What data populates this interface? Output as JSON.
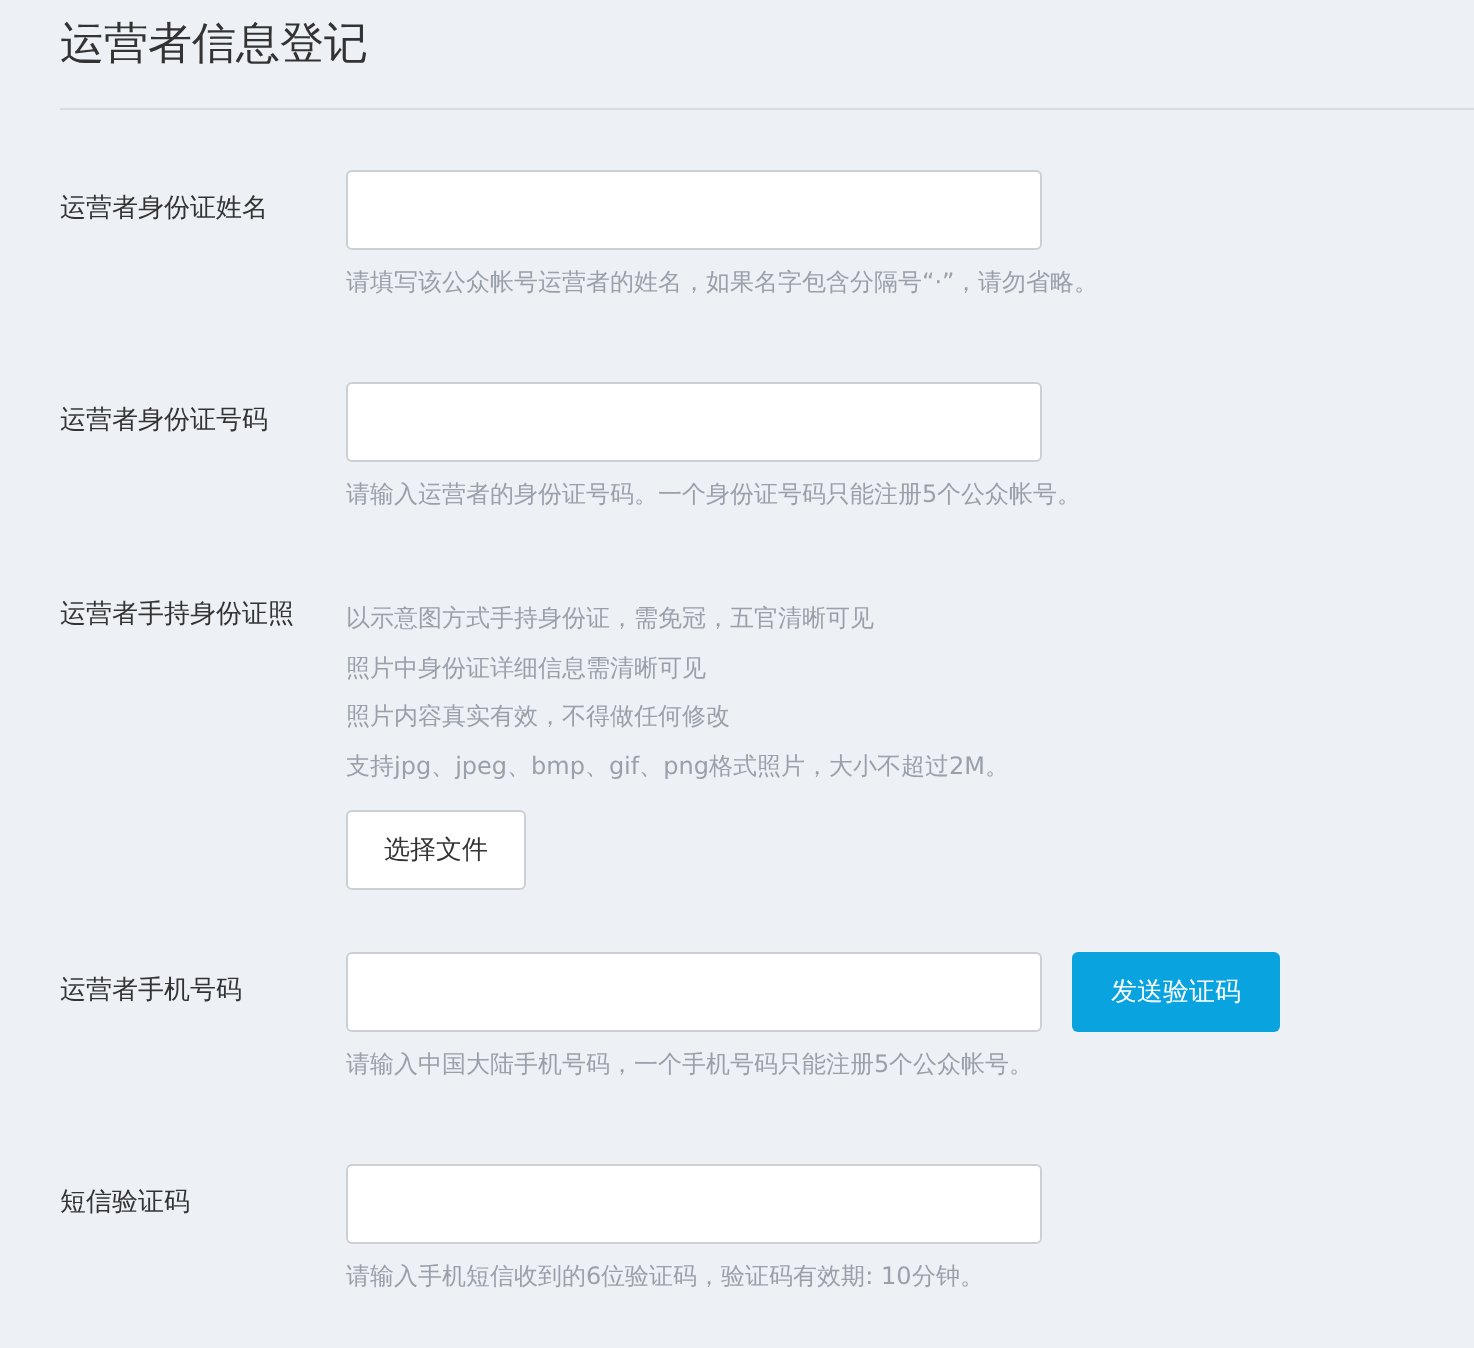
{
  "title": "运营者信息登记",
  "rows": [
    {
      "kind": "text",
      "label": "运营者身份证姓名",
      "hint": "请填写该公众帐号运营者的姓名，如果名字包含分隔号“·”，请勿省略。"
    },
    {
      "kind": "text",
      "label": "运营者身份证号码",
      "hint": "请输入运营者的身份证号码。一个身份证号码只能注册5个公众帐号。"
    },
    {
      "kind": "upload",
      "label": "运营者手持身份证照",
      "notes": [
        "以示意图方式手持身份证，需免冠，五官清晰可见",
        "照片中身份证详细信息需清晰可见",
        "照片内容真实有效，不得做任何修改",
        "支持jpg、jpeg、bmp、gif、png格式照片，大小不超过2M。"
      ],
      "button": "选择文件"
    },
    {
      "kind": "text",
      "label": "运营者手机号码",
      "hint": "请输入中国大陆手机号码，一个手机号码只能注册5个公众帐号。",
      "button": "发送验证码"
    },
    {
      "kind": "text",
      "label": "短信验证码",
      "hint": "请输入手机短信收到的6位验证码，验证码有效期: 10分钟。"
    }
  ]
}
